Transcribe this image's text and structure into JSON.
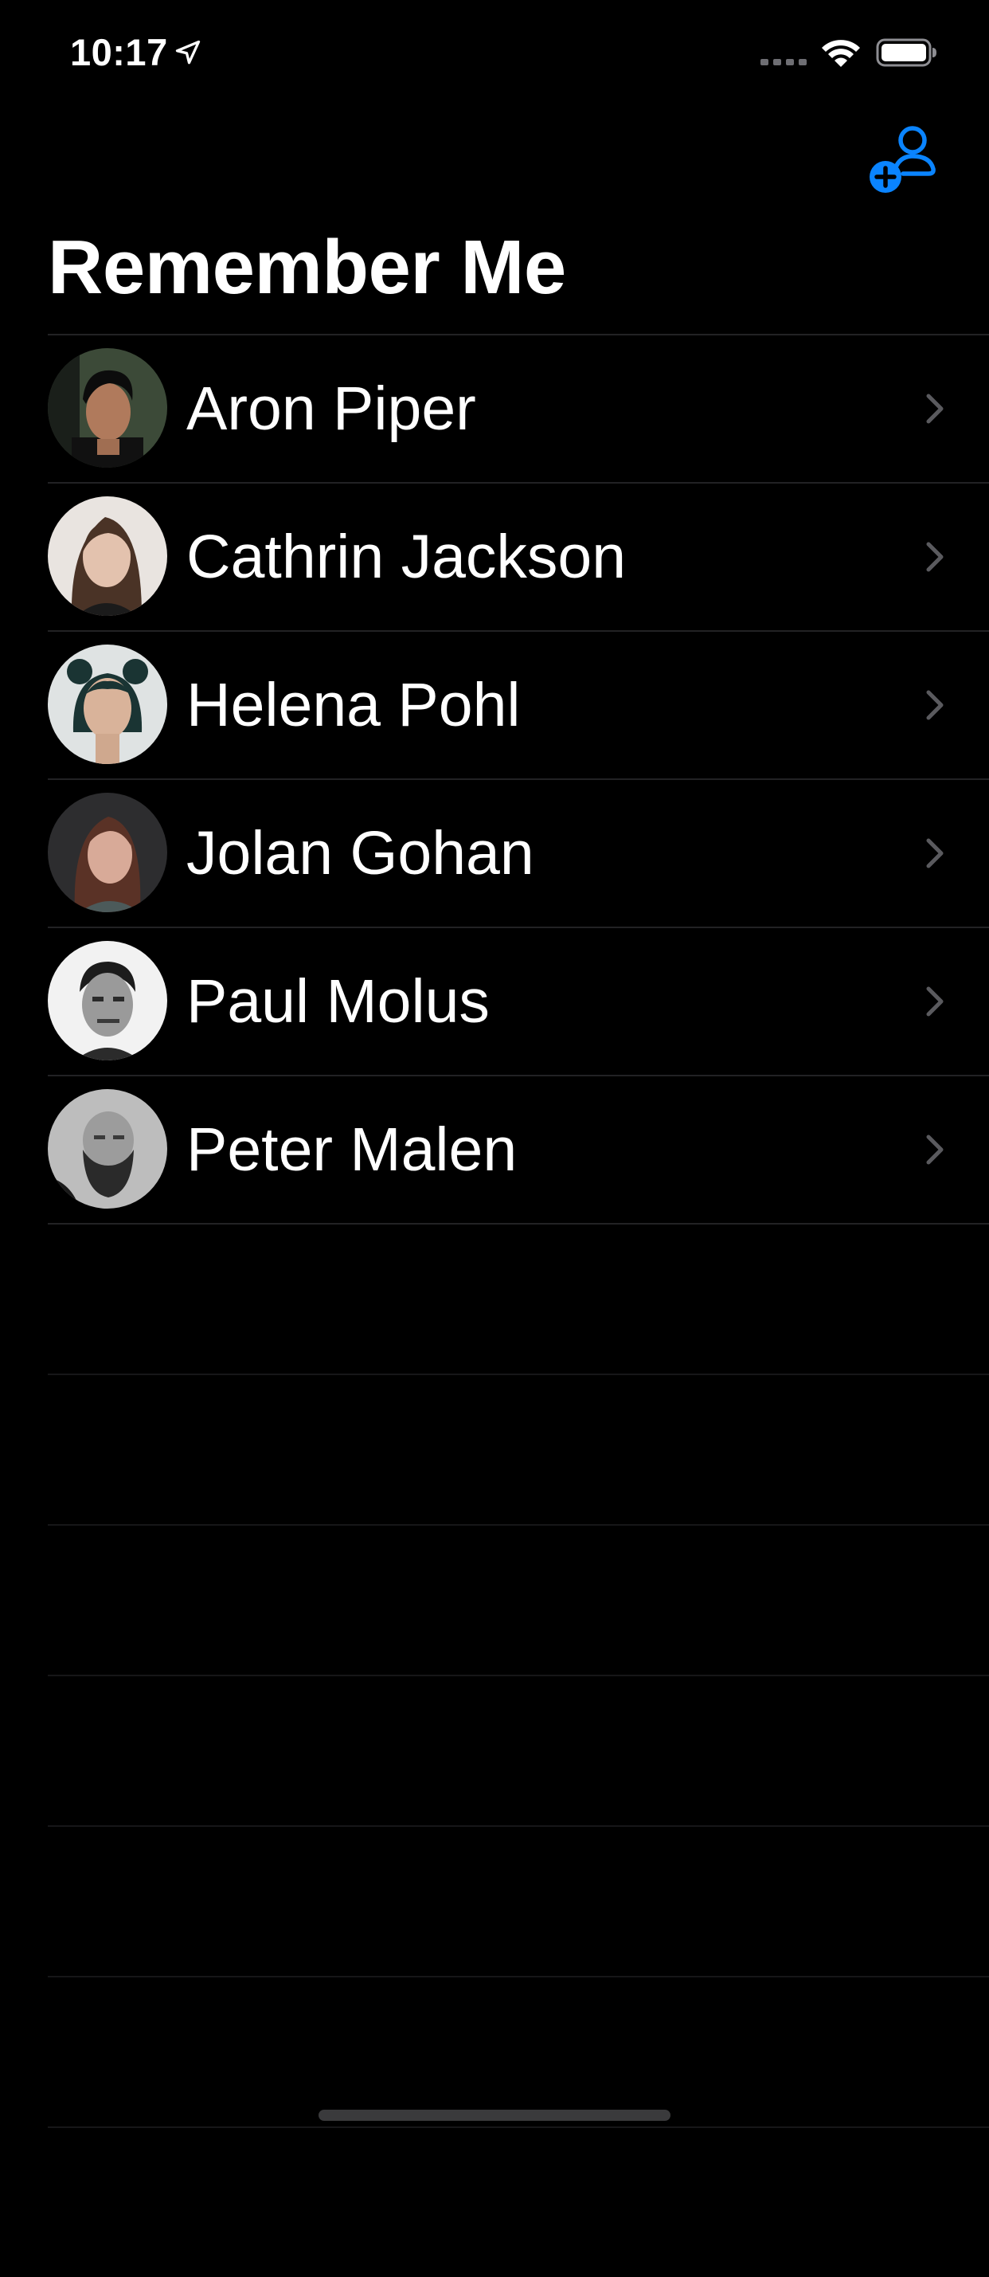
{
  "status_bar": {
    "time": "10:17",
    "icons": [
      "location-arrow-icon",
      "cellular-signal-icon",
      "wifi-icon",
      "battery-icon"
    ]
  },
  "nav": {
    "title": "Remember Me",
    "add_button_icon": "add-person-icon"
  },
  "colors": {
    "background": "#000000",
    "accent": "#0A84FF",
    "separator": "#222224",
    "chevron": "#5a5a5e",
    "text": "#ffffff"
  },
  "contacts": [
    {
      "name": "Aron Piper",
      "avatar_icon": "avatar-photo"
    },
    {
      "name": "Cathrin Jackson",
      "avatar_icon": "avatar-photo"
    },
    {
      "name": "Helena Pohl",
      "avatar_icon": "avatar-photo"
    },
    {
      "name": "Jolan Gohan",
      "avatar_icon": "avatar-photo"
    },
    {
      "name": "Paul Molus",
      "avatar_icon": "avatar-photo"
    },
    {
      "name": "Peter Malen",
      "avatar_icon": "avatar-photo"
    }
  ]
}
